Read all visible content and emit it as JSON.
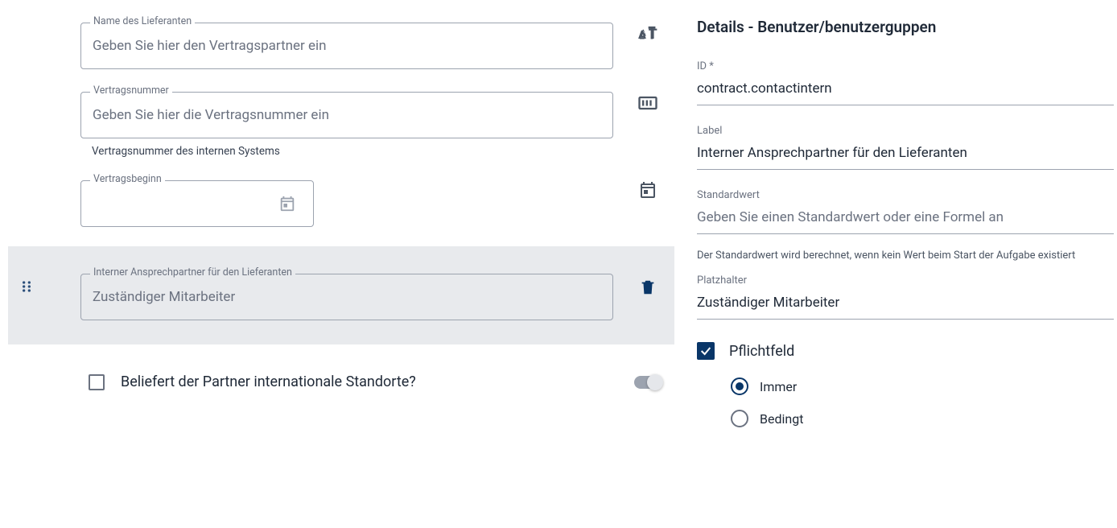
{
  "form": {
    "supplier_name": {
      "label": "Name des Lieferanten",
      "placeholder": "Geben Sie hier den Vertragspartner ein"
    },
    "contract_number": {
      "label": "Vertragsnummer",
      "placeholder": "Geben Sie hier die Vertragsnummer ein",
      "hint": "Vertragsnummer des internen Systems"
    },
    "contract_start": {
      "label": "Vertragsbeginn"
    },
    "internal_contact": {
      "label": "Interner Ansprechpartner für den Lieferanten",
      "placeholder": "Zuständiger Mitarbeiter"
    },
    "international": {
      "label": "Beliefert der Partner internationale Standorte?"
    }
  },
  "details": {
    "title": "Details - Benutzer/benutzerguppen",
    "id_label": "ID *",
    "id_value": "contract.contactintern",
    "label_label": "Label",
    "label_value": "Interner Ansprechpartner für den Lieferanten",
    "default_label": "Standardwert",
    "default_placeholder": "Geben Sie einen Standardwert oder eine Formel an",
    "default_hint": "Der Standardwert wird berechnet, wenn kein Wert beim Start der Aufgabe existiert",
    "placeholder_label": "Platzhalter",
    "placeholder_value": "Zuständiger Mitarbeiter",
    "mandatory_label": "Pflichtfeld",
    "radio_always": "Immer",
    "radio_conditional": "Bedingt"
  }
}
